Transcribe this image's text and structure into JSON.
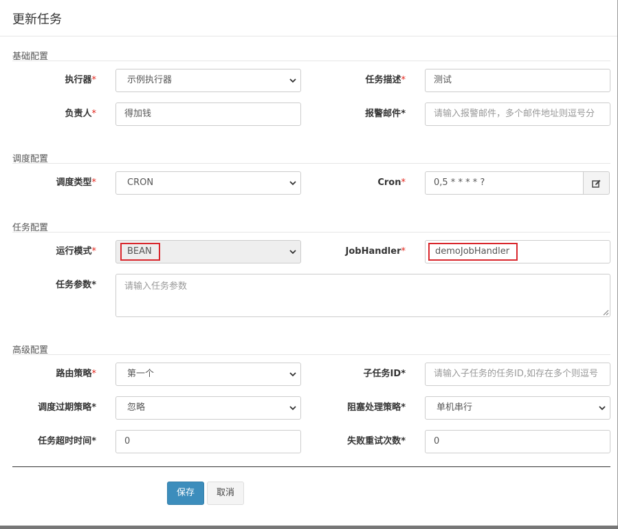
{
  "modal": {
    "title": "更新任务"
  },
  "sections": {
    "basic": "基础配置",
    "schedule": "调度配置",
    "task": "任务配置",
    "advanced": "高级配置"
  },
  "fields": {
    "executor": {
      "label": "执行器",
      "value": "示例执行器"
    },
    "job_desc": {
      "label": "任务描述",
      "value": "测试"
    },
    "author": {
      "label": "负责人",
      "value": "得加钱"
    },
    "alarm_email": {
      "label": "报警邮件",
      "placeholder": "请输入报警邮件，多个邮件地址则逗号分"
    },
    "schedule_type": {
      "label": "调度类型",
      "value": "CRON"
    },
    "cron": {
      "label": "Cron",
      "value": "0,5 * * * * ?"
    },
    "glue_type": {
      "label": "运行模式",
      "value": "BEAN"
    },
    "job_handler": {
      "label": "JobHandler",
      "value": "demoJobHandler"
    },
    "job_param": {
      "label": "任务参数",
      "placeholder": "请输入任务参数"
    },
    "route_strategy": {
      "label": "路由策略",
      "value": "第一个"
    },
    "child_job_id": {
      "label": "子任务ID",
      "placeholder": "请输入子任务的任务ID,如存在多个则逗号"
    },
    "misfire_strategy": {
      "label": "调度过期策略",
      "value": "忽略"
    },
    "block_strategy": {
      "label": "阻塞处理策略",
      "value": "单机串行"
    },
    "timeout": {
      "label": "任务超时时间",
      "value": "0"
    },
    "fail_retry": {
      "label": "失败重试次数",
      "value": "0"
    }
  },
  "required_mark": "*",
  "buttons": {
    "save": "保存",
    "cancel": "取消"
  },
  "icons": {
    "cron_edit": "edit-icon",
    "select": "chevron-down-icon"
  },
  "colors": {
    "primary": "#3c8dbc",
    "required": "#e2231a",
    "highlight": "#d9262c"
  }
}
